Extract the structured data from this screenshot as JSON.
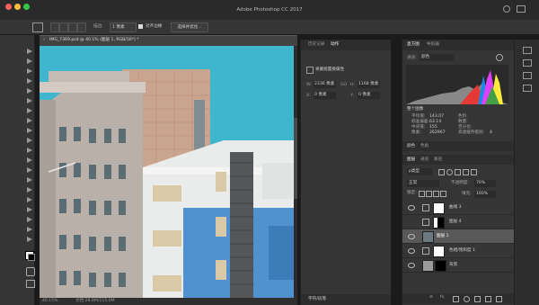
{
  "app": {
    "title": "Adobe Photoshop CC 2017"
  },
  "options_bar": {
    "mode_value": "1 像素",
    "mode_label": "描边:",
    "align_edges_label": "对齐边缘",
    "select_mask_label": "选择并遮住..."
  },
  "document": {
    "tab_title": "IMG_7369.psd @ 40.1% (图层 1, RGB/16*) *",
    "status_zoom": "40.15%",
    "status_doc": "文档:28.8M/115.0M"
  },
  "mid_panel": {
    "tabs": [
      "历史记录",
      "动作"
    ],
    "props_title": "将蒙版置换属性",
    "w_label": "W:",
    "w_value": "2336 像素",
    "link_label": "GO",
    "h_label": "H:",
    "h_value": "1168 像素",
    "x_label": "X:",
    "x_value": "0 像素",
    "y_label": "Y:",
    "y_value": "0 像素",
    "bottom_tab": "字符/段落"
  },
  "histogram_panel": {
    "tabs": [
      "直方图",
      "导航器"
    ],
    "channel_label": "通道:",
    "channel_value": "颜色",
    "source_value": "整个图像",
    "stats": [
      {
        "label": "平均值:",
        "value": "143.07"
      },
      {
        "label": "标准偏差:",
        "value": "63.14"
      },
      {
        "label": "中间值:",
        "value": "155"
      },
      {
        "label": "像素:",
        "value": "262967"
      }
    ],
    "stats_right": [
      {
        "label": "色阶:",
        "value": ""
      },
      {
        "label": "数量:",
        "value": ""
      },
      {
        "label": "百分位:",
        "value": ""
      },
      {
        "label": "高速缓存级别:",
        "value": "4"
      }
    ]
  },
  "color_panel": {
    "tabs": [
      "颜色",
      "色板"
    ]
  },
  "layers_panel": {
    "tabs": [
      "图层",
      "通道",
      "路径"
    ],
    "kind_label": "p类型",
    "blend_mode": "正常",
    "opacity_label": "不透明度:",
    "opacity_value": "70%",
    "lock_label": "锁定:",
    "fill_label": "填充:",
    "fill_value": "100%",
    "layers": [
      {
        "name": "曲线 3",
        "selected": false
      },
      {
        "name": "图层 4",
        "selected": false
      },
      {
        "name": "图层 1",
        "selected": true
      },
      {
        "name": "色相/饱和度 1",
        "selected": false
      },
      {
        "name": "背景",
        "selected": false
      }
    ]
  },
  "colors": {
    "sky": "#3fb6cf",
    "panel_bg": "#353535",
    "selected_layer": "#595959"
  }
}
